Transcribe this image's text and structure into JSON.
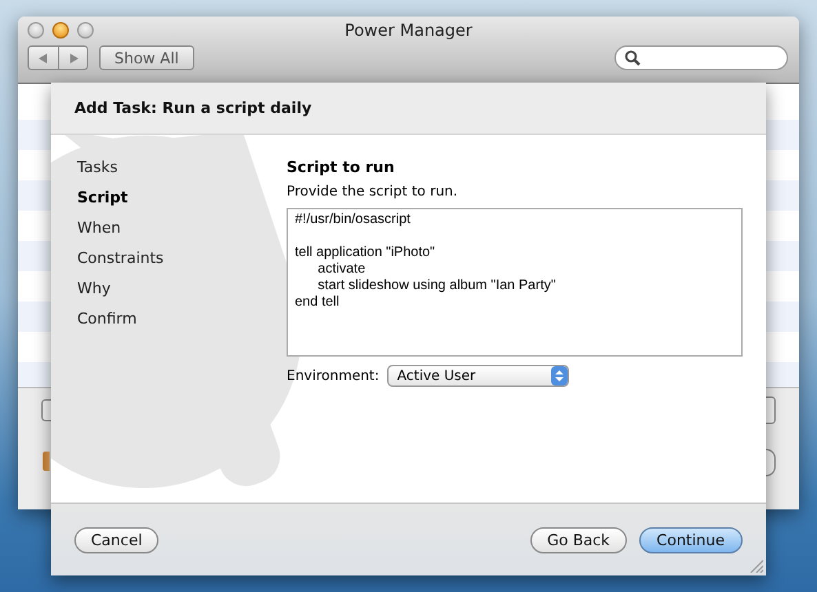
{
  "window": {
    "title": "Power Manager"
  },
  "toolbar": {
    "show_all": "Show All"
  },
  "sheet": {
    "title": "Add Task: Run a script daily",
    "steps": [
      {
        "label": "Tasks",
        "selected": false
      },
      {
        "label": "Script",
        "selected": true
      },
      {
        "label": "When",
        "selected": false
      },
      {
        "label": "Constraints",
        "selected": false
      },
      {
        "label": "Why",
        "selected": false
      },
      {
        "label": "Confirm",
        "selected": false
      }
    ],
    "heading": "Script to run",
    "instruction": "Provide the script to run.",
    "script": "#!/usr/bin/osascript\n\ntell application \"iPhoto\"\n\tactivate\n\tstart slideshow using album \"Ian Party\"\nend tell",
    "environment": {
      "label": "Environment:",
      "value": "Active User"
    },
    "buttons": [
      {
        "label": "Cancel",
        "kind": "plain"
      },
      {
        "label": "Go Back",
        "kind": "plain"
      },
      {
        "label": "Continue",
        "kind": "default"
      }
    ]
  }
}
